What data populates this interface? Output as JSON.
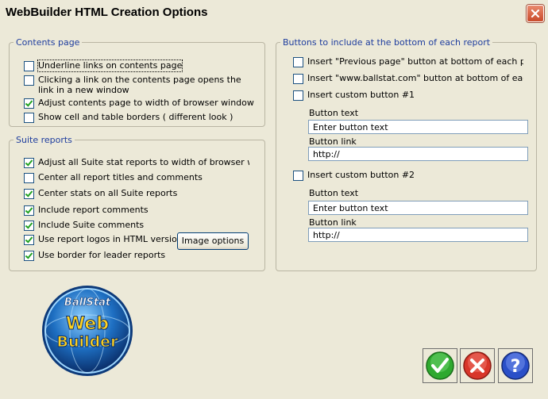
{
  "window": {
    "title": "WebBuilder HTML Creation Options"
  },
  "contents_page": {
    "legend": "Contents page",
    "items": [
      {
        "label": "Underline links on contents page",
        "checked": false
      },
      {
        "label": "Clicking a link on the contents page opens the link in a new window",
        "checked": false
      },
      {
        "label": "Adjust contents page to width of browser window",
        "checked": true
      },
      {
        "label": "Show cell and table borders ( different look )",
        "checked": false
      }
    ]
  },
  "suite_reports": {
    "legend": "Suite reports",
    "items": [
      {
        "label": "Adjust all Suite stat reports to width of browser window",
        "checked": true
      },
      {
        "label": "Center all report titles and comments",
        "checked": false
      },
      {
        "label": "Center stats on all Suite reports",
        "checked": true
      },
      {
        "label": "Include report comments",
        "checked": true
      },
      {
        "label": "Include Suite comments",
        "checked": true
      },
      {
        "label": "Use report logos in HTML version",
        "checked": true
      },
      {
        "label": "Use border for leader reports",
        "checked": true
      }
    ],
    "image_options_label": "Image options"
  },
  "bottom_buttons": {
    "legend": "Buttons to include at the bottom of each report",
    "items": [
      {
        "label": "Insert \"Previous page\" button at bottom of each page",
        "checked": false
      },
      {
        "label": "Insert \"www.ballstat.com\" button at bottom of each page",
        "checked": false
      },
      {
        "label": "Insert custom button #1",
        "checked": false
      },
      {
        "label": "Insert custom button #2",
        "checked": false
      }
    ],
    "custom1": {
      "text_label": "Button text",
      "text_value": "Enter button text",
      "link_label": "Button link",
      "link_value": "http://"
    },
    "custom2": {
      "text_label": "Button text",
      "text_value": "Enter button text",
      "link_label": "Button link",
      "link_value": "http://"
    }
  },
  "logo": {
    "line1": "BallStat",
    "line2": "Web",
    "line3": "Builder"
  },
  "actions": {
    "ok_icon": "checkmark-icon",
    "cancel_icon": "x-icon",
    "help_icon": "question-icon"
  },
  "colors": {
    "legend_blue": "#1e3d9e",
    "ok_green": "#2fa92f",
    "cancel_red": "#d8362a",
    "help_blue": "#2a4fc8"
  }
}
